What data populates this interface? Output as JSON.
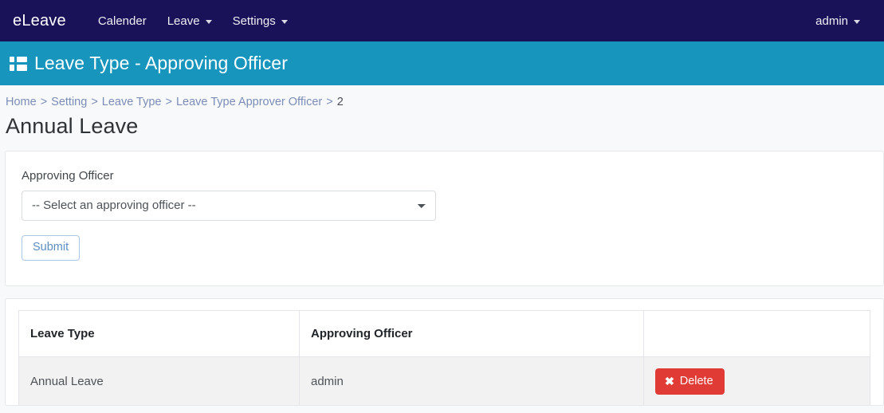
{
  "navbar": {
    "brand": "eLeave",
    "links": [
      {
        "label": "Calender",
        "has_caret": false,
        "icon": ""
      },
      {
        "label": "Leave",
        "has_caret": true,
        "icon": "caret-down-icon"
      },
      {
        "label": "Settings",
        "has_caret": true,
        "icon": "caret-down-icon"
      }
    ],
    "user": {
      "label": "admin",
      "has_caret": true,
      "icon": "caret-down-icon"
    },
    "background_color": "#191259"
  },
  "page_band": {
    "icon": "th-list-icon",
    "title": "Leave Type - Approving Officer",
    "background_color": "#1895bd"
  },
  "breadcrumb": {
    "items": [
      {
        "label": "Home",
        "is_link": true
      },
      {
        "label": "Setting",
        "is_link": true
      },
      {
        "label": "Leave Type",
        "is_link": true
      },
      {
        "label": "Leave Type Approver Officer",
        "is_link": true
      },
      {
        "label": "2",
        "is_link": false
      }
    ],
    "separator": ">"
  },
  "page_title": "Annual Leave",
  "form": {
    "field_label": "Approving Officer",
    "select": {
      "selected": "-- Select an approving officer --",
      "options": [
        "-- Select an approving officer --"
      ]
    },
    "submit_label": "Submit"
  },
  "table": {
    "columns": [
      "Leave Type",
      "Approving Officer",
      ""
    ],
    "rows": [
      {
        "leave_type": "Annual Leave",
        "approving_officer": "admin",
        "action_label": "Delete",
        "action_icon": "times-icon",
        "action_color": "#e13b36"
      }
    ]
  }
}
